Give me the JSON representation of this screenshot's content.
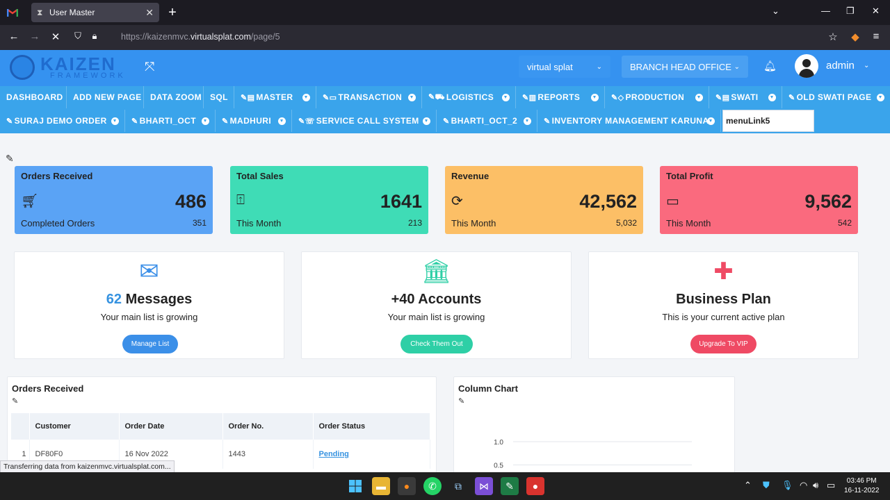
{
  "browser": {
    "tab_title": "User Master",
    "url_prefix": "https://kaizenmvc.",
    "url_domain": "virtualsplat.com",
    "url_path": "/page/5",
    "status_text": "Transferring data from kaizenmvc.virtualsplat.com..."
  },
  "header": {
    "logo_title": "KAIZEN",
    "logo_sub": "FRAMEWORK",
    "company_select": "virtual splat",
    "branch_select": "BRANCH HEAD OFFICE",
    "user_name": "admin"
  },
  "menu": {
    "row1": [
      {
        "label": "DASHBOARD"
      },
      {
        "label": "ADD NEW PAGE"
      },
      {
        "label": "DATA ZOOM"
      },
      {
        "label": "SQL"
      },
      {
        "label": "MASTER"
      },
      {
        "label": "TRANSACTION"
      },
      {
        "label": "LOGISTICS"
      },
      {
        "label": "REPORTS"
      },
      {
        "label": "PRODUCTION"
      },
      {
        "label": "SWATI"
      },
      {
        "label": "OLD SWATI PAGE"
      }
    ],
    "row2": [
      {
        "label": "SURAJ DEMO ORDER"
      },
      {
        "label": "BHARTI_OCT"
      },
      {
        "label": "MADHURI"
      },
      {
        "label": "SERVICE CALL SYSTEM"
      },
      {
        "label": "BHARTI_OCT_2"
      },
      {
        "label": "INVENTORY MANAGEMENT KARUNA"
      }
    ],
    "new_menu_value": "menuLink5"
  },
  "stats": [
    {
      "title": "Orders Received",
      "value": "486",
      "sub": "Completed Orders",
      "count": "351",
      "color": "#5aa3f5"
    },
    {
      "title": "Total Sales",
      "value": "1641",
      "sub": "This Month",
      "count": "213",
      "color": "#3fdcb6"
    },
    {
      "title": "Revenue",
      "value": "42,562",
      "sub": "This Month",
      "count": "5,032",
      "color": "#fcbf66"
    },
    {
      "title": "Total Profit",
      "value": "9,562",
      "sub": "This Month",
      "count": "542",
      "color": "#fa6a7e"
    }
  ],
  "info_cards": [
    {
      "accent": "62",
      "title": " Messages",
      "sub": "Your main list is growing",
      "button": "Manage List",
      "color": "#3b8fe8"
    },
    {
      "accent": "",
      "title": "+40 Accounts",
      "sub": "Your main list is growing",
      "button": "Check Them Out",
      "color": "#2ecfa6"
    },
    {
      "accent": "",
      "title": "Business Plan",
      "sub": "This is your current active plan",
      "button": "Upgrade To VIP",
      "color": "#ef4a64"
    }
  ],
  "orders_panel": {
    "title": "Orders Received",
    "columns": [
      "Customer",
      "Order Date",
      "Order No.",
      "Order Status"
    ],
    "rows": [
      {
        "index": "1",
        "customer": "DF80F0",
        "date": "16 Nov 2022",
        "order_no": "1443",
        "status": "Pending"
      }
    ]
  },
  "chart_panel": {
    "title": "Column Chart"
  },
  "chart_data": {
    "type": "bar",
    "title": "Column Chart",
    "categories": [],
    "values": [],
    "ylim": [
      0,
      1.0
    ],
    "y_ticks": [
      "1.0",
      "0.5"
    ],
    "grid": true
  },
  "taskbar": {
    "time": "03:46 PM",
    "date": "16-11-2022"
  }
}
